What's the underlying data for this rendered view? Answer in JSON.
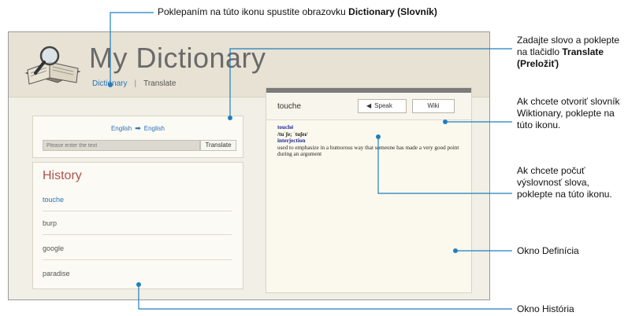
{
  "app": {
    "title": "My Dictionary",
    "nav": {
      "dictionary": "Dictionary",
      "separator": "|",
      "translate": "Translate"
    }
  },
  "translate_panel": {
    "source_lang": "English",
    "target_lang": "English",
    "input_placeholder": "Please enter the text",
    "button_label": "Translate"
  },
  "history": {
    "title": "History",
    "items": [
      "touche",
      "burp",
      "google",
      "paradise"
    ],
    "active_index": 0
  },
  "definition": {
    "word": "touche",
    "speak_label": "Speak",
    "wiki_label": "Wiki",
    "headword": "touché",
    "pronunciation": "/tuˈʃe; ˈtuʃeɪ/",
    "part_of_speech": "interjection",
    "meaning": "used to emphasize in a humorous way that someone has made a very good point during an argument"
  },
  "callouts": {
    "dictionary_icon": {
      "prefix": "Poklepaním na túto ikonu spustite obrazovku ",
      "bold": "Dictionary (Slovník)"
    },
    "translate_button": {
      "prefix": "Zadajte slovo a poklepte na tlačidlo ",
      "bold": "Translate (Preložiť)"
    },
    "wiki_button": "Ak chcete otvoriť slovník Wiktionary, poklepte na túto ikonu.",
    "speak_button": "Ak chcete počuť výslovnosť slova, poklepte na túto ikonu.",
    "definition_window": "Okno Definícia",
    "history_window": "Okno História"
  },
  "colors": {
    "callout_line": "#1f7fbf",
    "accent_blue": "#2a73b7",
    "history_red": "#b0524c"
  }
}
